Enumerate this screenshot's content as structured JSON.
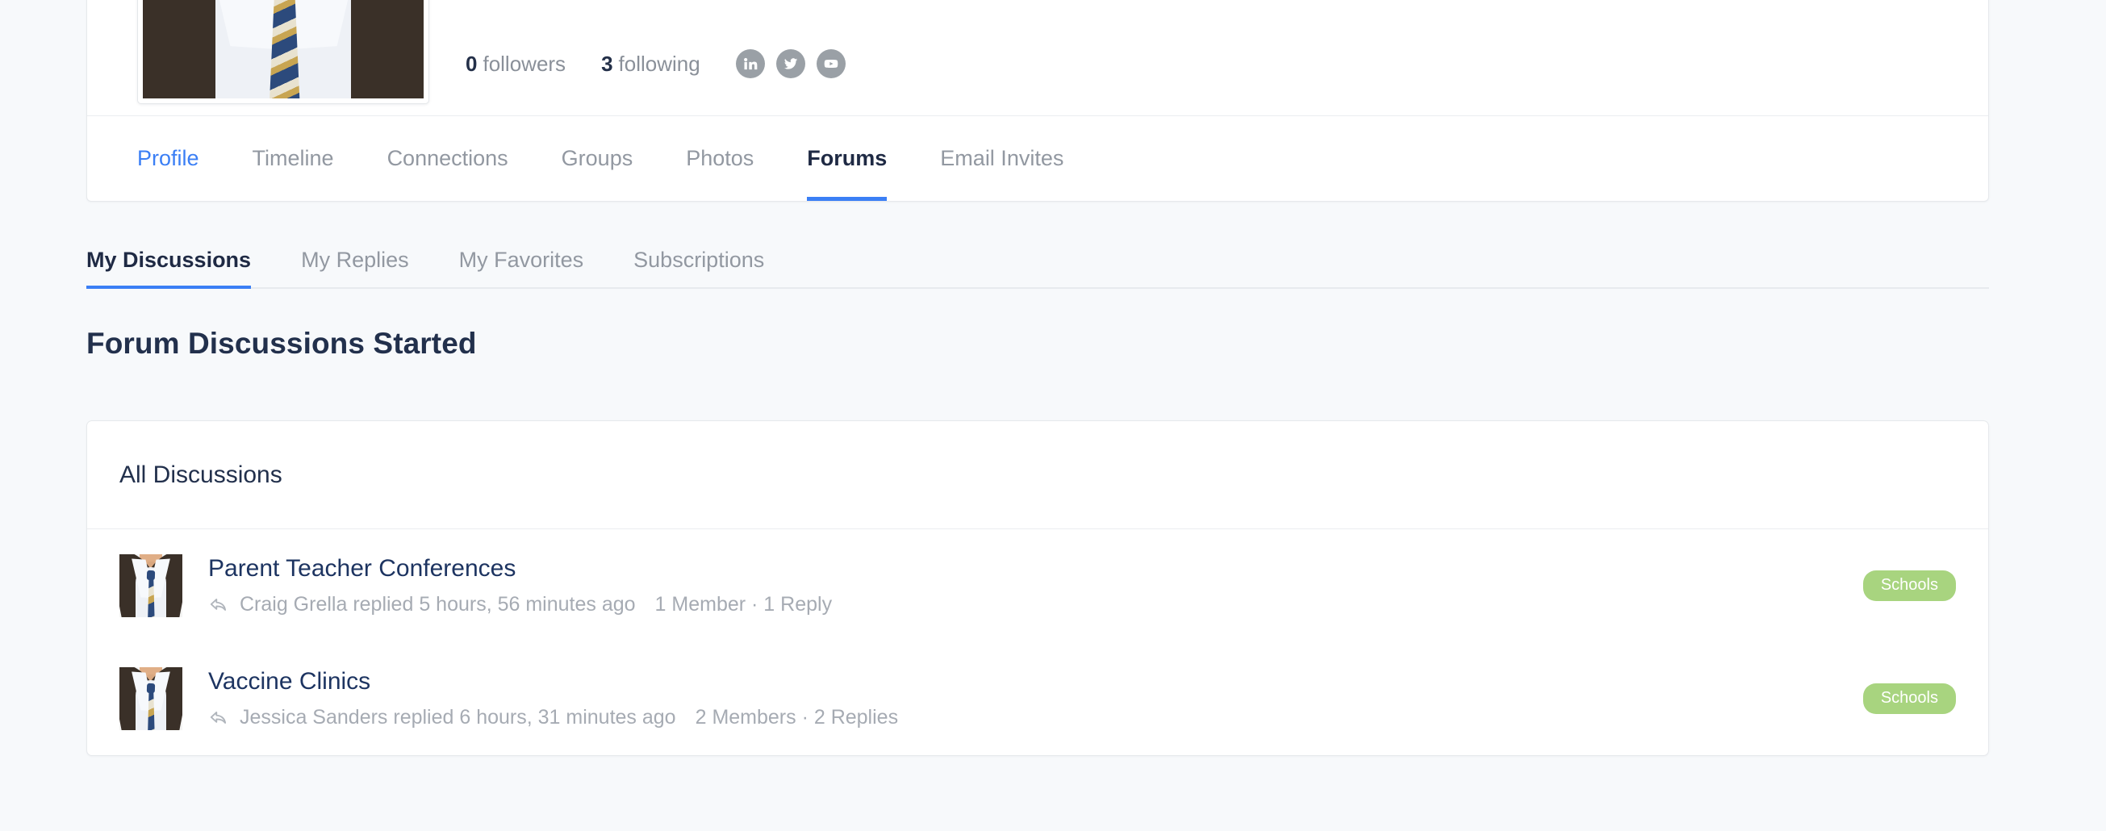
{
  "profile_header": {
    "avatar_alt": "profile-photo",
    "stats": [
      {
        "count": "0",
        "label": "followers"
      },
      {
        "count": "3",
        "label": "following"
      }
    ],
    "social_links": [
      {
        "name": "linkedin-icon",
        "label": "LinkedIn"
      },
      {
        "name": "twitter-icon",
        "label": "Twitter"
      },
      {
        "name": "youtube-icon",
        "label": "YouTube"
      }
    ]
  },
  "nav_tabs": [
    {
      "label": "Profile",
      "state": "link"
    },
    {
      "label": "Timeline",
      "state": "default"
    },
    {
      "label": "Connections",
      "state": "default"
    },
    {
      "label": "Groups",
      "state": "default"
    },
    {
      "label": "Photos",
      "state": "default"
    },
    {
      "label": "Forums",
      "state": "active"
    },
    {
      "label": "Email Invites",
      "state": "default"
    }
  ],
  "sub_tabs": [
    {
      "label": "My Discussions",
      "state": "active"
    },
    {
      "label": "My Replies",
      "state": "default"
    },
    {
      "label": "My Favorites",
      "state": "default"
    },
    {
      "label": "Subscriptions",
      "state": "default"
    }
  ],
  "section": {
    "title": "Forum Discussions Started"
  },
  "discussions_card": {
    "header_title": "All Discussions",
    "rows": [
      {
        "title": "Parent Teacher Conferences",
        "reply_text": "Craig Grella replied 5 hours, 56 minutes ago",
        "counts": "1 Member · 1 Reply",
        "badge": "Schools"
      },
      {
        "title": "Vaccine Clinics",
        "reply_text": "Jessica Sanders replied 6 hours, 31 minutes ago",
        "counts": "2 Members · 2 Replies",
        "badge": "Schools"
      }
    ]
  },
  "colors": {
    "page_background": "#f7f9fb",
    "accent_blue": "#3b7ff5",
    "title_navy": "#22304c",
    "link_navy": "#1d3461",
    "muted_text": "#a6abb3",
    "badge_green": "#a8d47f",
    "social_gray": "#9aa0a6"
  }
}
